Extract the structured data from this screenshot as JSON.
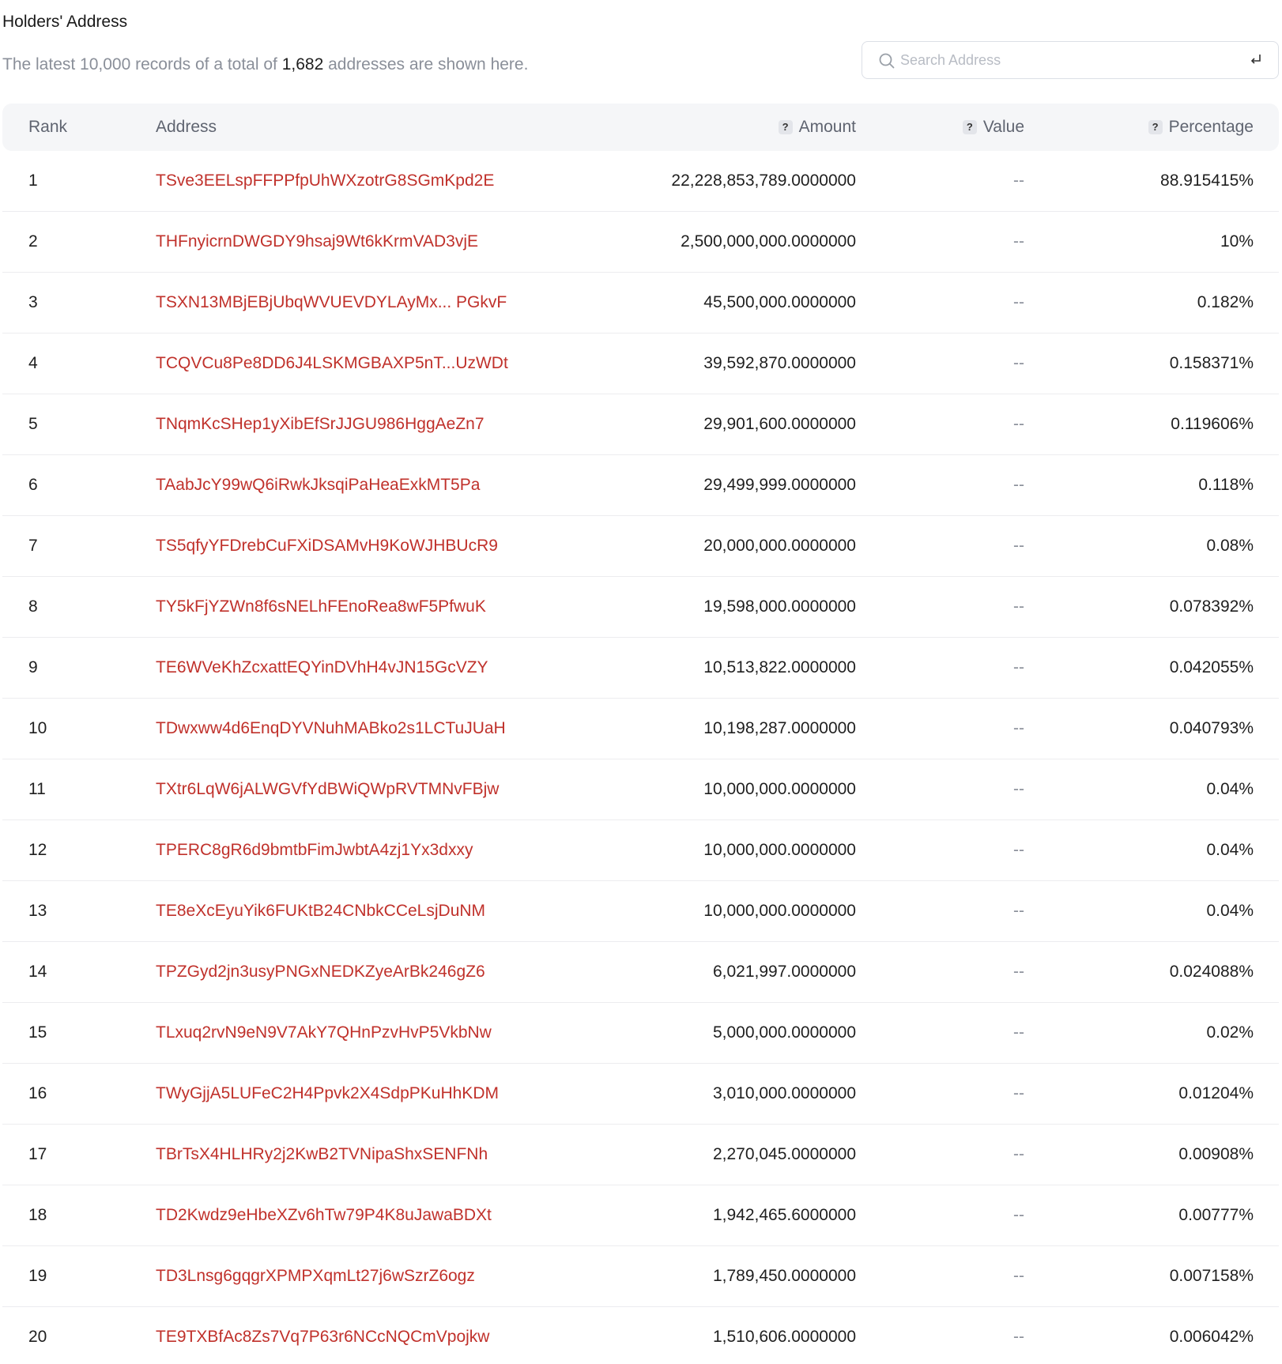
{
  "header": {
    "title": "Holders' Address",
    "summary_prefix": "The latest 10,000 records of a total of ",
    "summary_count": "1,682",
    "summary_suffix": " addresses are shown here."
  },
  "search": {
    "placeholder": "Search Address",
    "value": ""
  },
  "columns": {
    "rank": "Rank",
    "address": "Address",
    "amount": "Amount",
    "value": "Value",
    "percentage": "Percentage",
    "help_glyph": "?"
  },
  "colors": {
    "address_link": "#c0312b",
    "header_bg": "#f5f6f8",
    "muted_text": "#8a8f99"
  },
  "rows": [
    {
      "rank": "1",
      "address": "TSve3EELspFFPPfpUhWXzotrG8SGmKpd2E",
      "amount": "22,228,853,789.0000000",
      "value": "--",
      "percentage": "88.915415%"
    },
    {
      "rank": "2",
      "address": "THFnyicrnDWGDY9hsaj9Wt6kKrmVAD3vjE",
      "amount": "2,500,000,000.0000000",
      "value": "--",
      "percentage": "10%"
    },
    {
      "rank": "3",
      "address": "TSXN13MBjEBjUbqWVUEVDYLAyMx...  PGkvF",
      "amount": "45,500,000.0000000",
      "value": "--",
      "percentage": "0.182%"
    },
    {
      "rank": "4",
      "address": "TCQVCu8Pe8DD6J4LSKMGBAXP5nT...UzWDt",
      "amount": "39,592,870.0000000",
      "value": "--",
      "percentage": "0.158371%"
    },
    {
      "rank": "5",
      "address": "TNqmKcSHep1yXibEfSrJJGU986HggAeZn7",
      "amount": "29,901,600.0000000",
      "value": "--",
      "percentage": "0.119606%"
    },
    {
      "rank": "6",
      "address": "TAabJcY99wQ6iRwkJksqiPaHeaExkMT5Pa",
      "amount": "29,499,999.0000000",
      "value": "--",
      "percentage": "0.118%"
    },
    {
      "rank": "7",
      "address": "TS5qfyYFDrebCuFXiDSAMvH9KoWJHBUcR9",
      "amount": "20,000,000.0000000",
      "value": "--",
      "percentage": "0.08%"
    },
    {
      "rank": "8",
      "address": "TY5kFjYZWn8f6sNELhFEnoRea8wF5PfwuK",
      "amount": "19,598,000.0000000",
      "value": "--",
      "percentage": "0.078392%"
    },
    {
      "rank": "9",
      "address": "TE6WVeKhZcxattEQYinDVhH4vJN15GcVZY",
      "amount": "10,513,822.0000000",
      "value": "--",
      "percentage": "0.042055%"
    },
    {
      "rank": "10",
      "address": "TDwxww4d6EnqDYVNuhMABko2s1LCTuJUaH",
      "amount": "10,198,287.0000000",
      "value": "--",
      "percentage": "0.040793%"
    },
    {
      "rank": "11",
      "address": "TXtr6LqW6jALWGVfYdBWiQWpRVTMNvFBjw",
      "amount": "10,000,000.0000000",
      "value": "--",
      "percentage": "0.04%"
    },
    {
      "rank": "12",
      "address": "TPERC8gR6d9bmtbFimJwbtA4zj1Yx3dxxy",
      "amount": "10,000,000.0000000",
      "value": "--",
      "percentage": "0.04%"
    },
    {
      "rank": "13",
      "address": "TE8eXcEyuYik6FUKtB24CNbkCCeLsjDuNM",
      "amount": "10,000,000.0000000",
      "value": "--",
      "percentage": "0.04%"
    },
    {
      "rank": "14",
      "address": "TPZGyd2jn3usyPNGxNEDKZyeArBk246gZ6",
      "amount": "6,021,997.0000000",
      "value": "--",
      "percentage": "0.024088%"
    },
    {
      "rank": "15",
      "address": "TLxuq2rvN9eN9V7AkY7QHnPzvHvP5VkbNw",
      "amount": "5,000,000.0000000",
      "value": "--",
      "percentage": "0.02%"
    },
    {
      "rank": "16",
      "address": "TWyGjjA5LUFeC2H4Ppvk2X4SdpPKuHhKDM",
      "amount": "3,010,000.0000000",
      "value": "--",
      "percentage": "0.01204%"
    },
    {
      "rank": "17",
      "address": "TBrTsX4HLHRy2j2KwB2TVNipaShxSENFNh",
      "amount": "2,270,045.0000000",
      "value": "--",
      "percentage": "0.00908%"
    },
    {
      "rank": "18",
      "address": "TD2Kwdz9eHbeXZv6hTw79P4K8uJawaBDXt",
      "amount": "1,942,465.6000000",
      "value": "--",
      "percentage": "0.00777%"
    },
    {
      "rank": "19",
      "address": "TD3Lnsg6gqgrXPMPXqmLt27j6wSzrZ6ogz",
      "amount": "1,789,450.0000000",
      "value": "--",
      "percentage": "0.007158%"
    },
    {
      "rank": "20",
      "address": "TE9TXBfAc8Zs7Vq7P63r6NCcNQCmVpojkw",
      "amount": "1,510,606.0000000",
      "value": "--",
      "percentage": "0.006042%"
    }
  ]
}
